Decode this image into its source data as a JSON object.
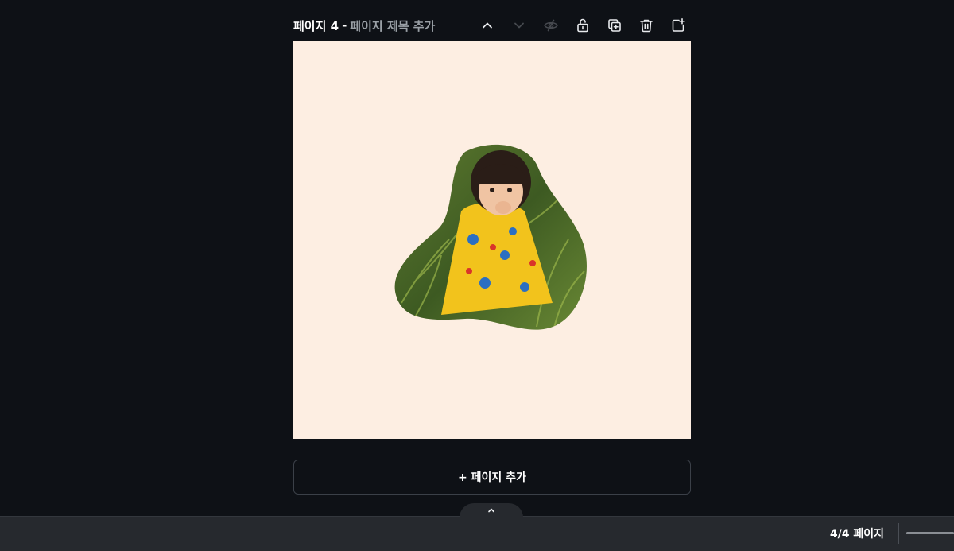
{
  "page": {
    "number_label": "페이지 4",
    "separator": "-",
    "title_placeholder": "페이지 제목 추가"
  },
  "toolbar": {
    "items": [
      {
        "name": "move-up",
        "icon": "chevron-up-icon",
        "enabled": true
      },
      {
        "name": "move-down",
        "icon": "chevron-down-icon",
        "enabled": false
      },
      {
        "name": "hide-page",
        "icon": "eye-off-icon",
        "enabled": false
      },
      {
        "name": "lock-page",
        "icon": "unlock-icon",
        "enabled": true
      },
      {
        "name": "duplicate-page",
        "icon": "duplicate-icon",
        "enabled": true
      },
      {
        "name": "delete-page",
        "icon": "trash-icon",
        "enabled": true
      },
      {
        "name": "add-page",
        "icon": "add-page-icon",
        "enabled": true
      }
    ]
  },
  "canvas": {
    "background": "#fdeee2",
    "image_description_icon": "child-photo-blob-frame"
  },
  "add_page_button": {
    "label": "+ 페이지 추가"
  },
  "bottom_bar": {
    "page_count": "4/4 페이지",
    "expand_icon": "chevron-up-icon"
  },
  "colors": {
    "background": "#0e1116",
    "bottom_bar": "#26292e",
    "canvas": "#fdeee2"
  }
}
